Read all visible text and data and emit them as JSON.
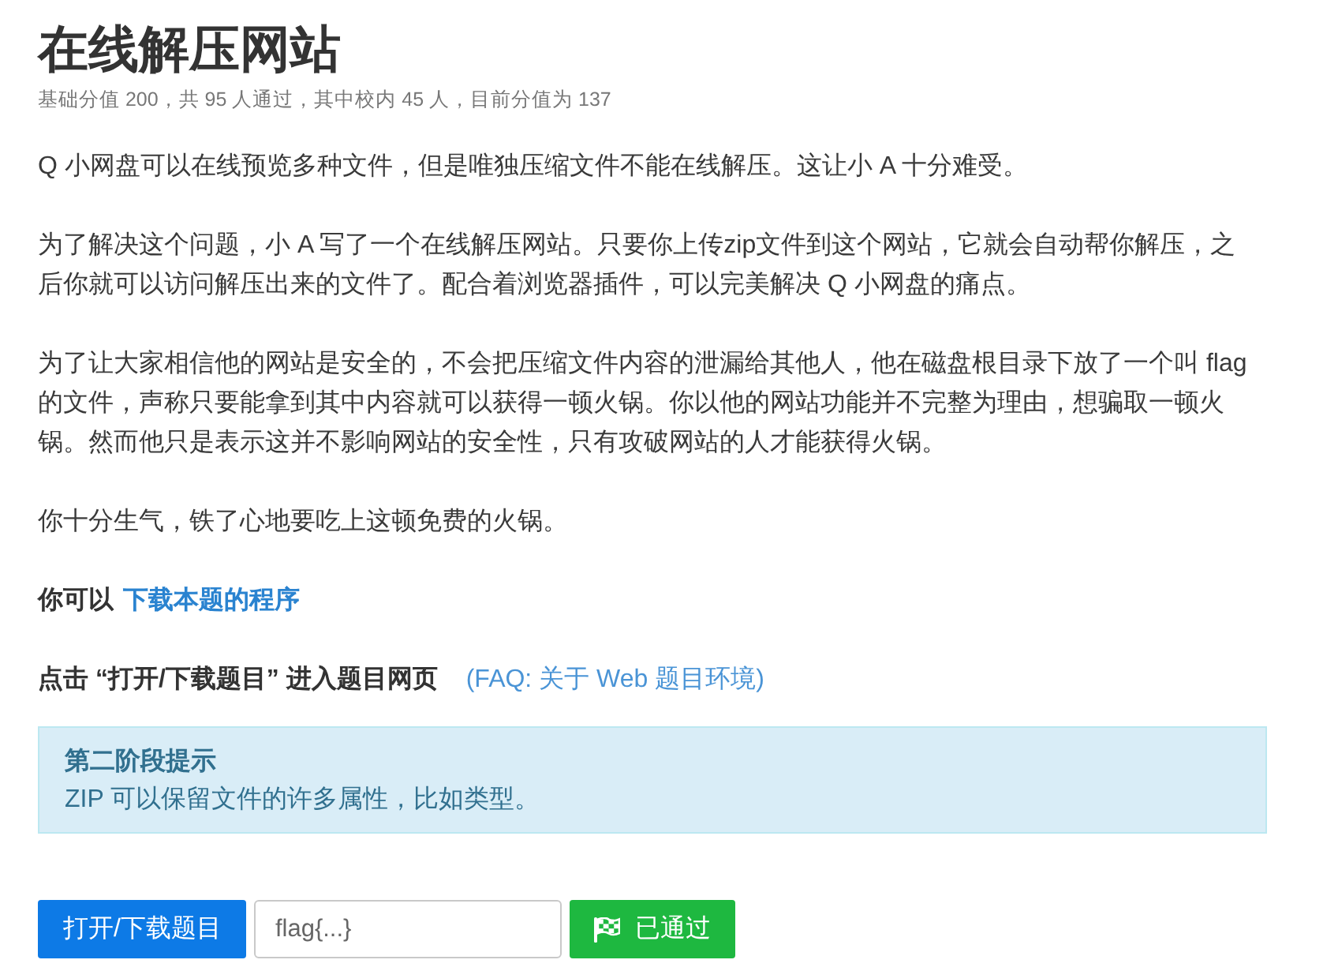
{
  "title": "在线解压网站",
  "subtitle": "基础分值 200，共 95 人通过，其中校内 45 人，目前分值为 137",
  "paragraphs": [
    "Q 小网盘可以在线预览多种文件，但是唯独压缩文件不能在线解压。这让小 A 十分难受。",
    "为了解决这个问题，小 A 写了一个在线解压网站。只要你上传zip文件到这个网站，它就会自动帮你解压，之后你就可以访问解压出来的文件了。配合着浏览器插件，可以完美解决 Q 小网盘的痛点。",
    "为了让大家相信他的网站是安全的，不会把压缩文件内容的泄漏给其他人，他在磁盘根目录下放了一个叫 flag 的文件，声称只要能拿到其中内容就可以获得一顿火锅。你以他的网站功能并不完整为理由，想骗取一顿火锅。然而他只是表示这并不影响网站的安全性，只有攻破网站的人才能获得火锅。",
    "你十分生气，铁了心地要吃上这顿免费的火锅。"
  ],
  "download": {
    "text": "你可以",
    "link": "下载本题的程序"
  },
  "instruction": {
    "text": "点击 “打开/下载题目” 进入题目网页",
    "link": "(FAQ: 关于 Web 题目环境)"
  },
  "hint": {
    "title": "第二阶段提示",
    "text": "ZIP 可以保留文件的许多属性，比如类型。"
  },
  "actions": {
    "open_button": "打开/下载题目",
    "flag_field": {
      "placeholder": "flag{...}"
    },
    "status_button": {
      "label": "已通过",
      "passed": true
    }
  }
}
